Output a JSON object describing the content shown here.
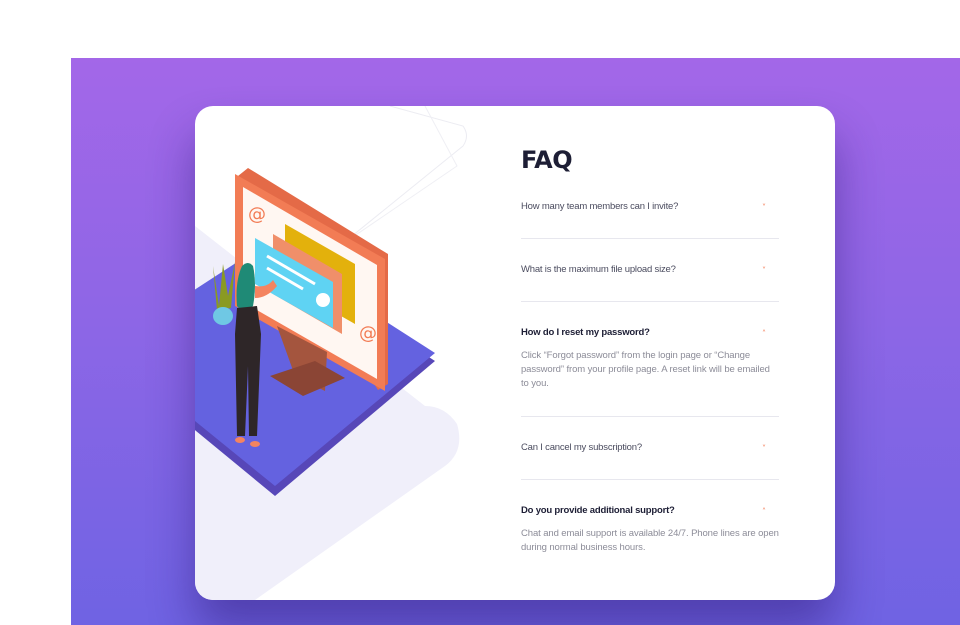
{
  "faq": {
    "title": "FAQ",
    "items": [
      {
        "question": "How many team members can I invite?",
        "answer": "",
        "open": false
      },
      {
        "question": "What is the maximum file upload size?",
        "answer": "",
        "open": false
      },
      {
        "question": "How do I reset my password?",
        "answer": "Click “Forgot password” from the login page or “Change password” from your profile page. A reset link will be emailed to you.",
        "open": true
      },
      {
        "question": "Can I cancel my subscription?",
        "answer": "",
        "open": false
      },
      {
        "question": "Do you provide additional support?",
        "answer": "Chat and email support is available 24/7. Phone lines are open during normal business hours.",
        "open": true
      }
    ],
    "arrow_collapsed": "˅",
    "arrow_expanded": "˄"
  },
  "colors": {
    "bg_top": "#a367e8",
    "bg_bottom": "#6f63e3",
    "title": "#1d1e35",
    "accent": "#f47b56",
    "divider": "#e7e7ee"
  },
  "illustration": {
    "name": "woman-at-computer-illustration"
  }
}
